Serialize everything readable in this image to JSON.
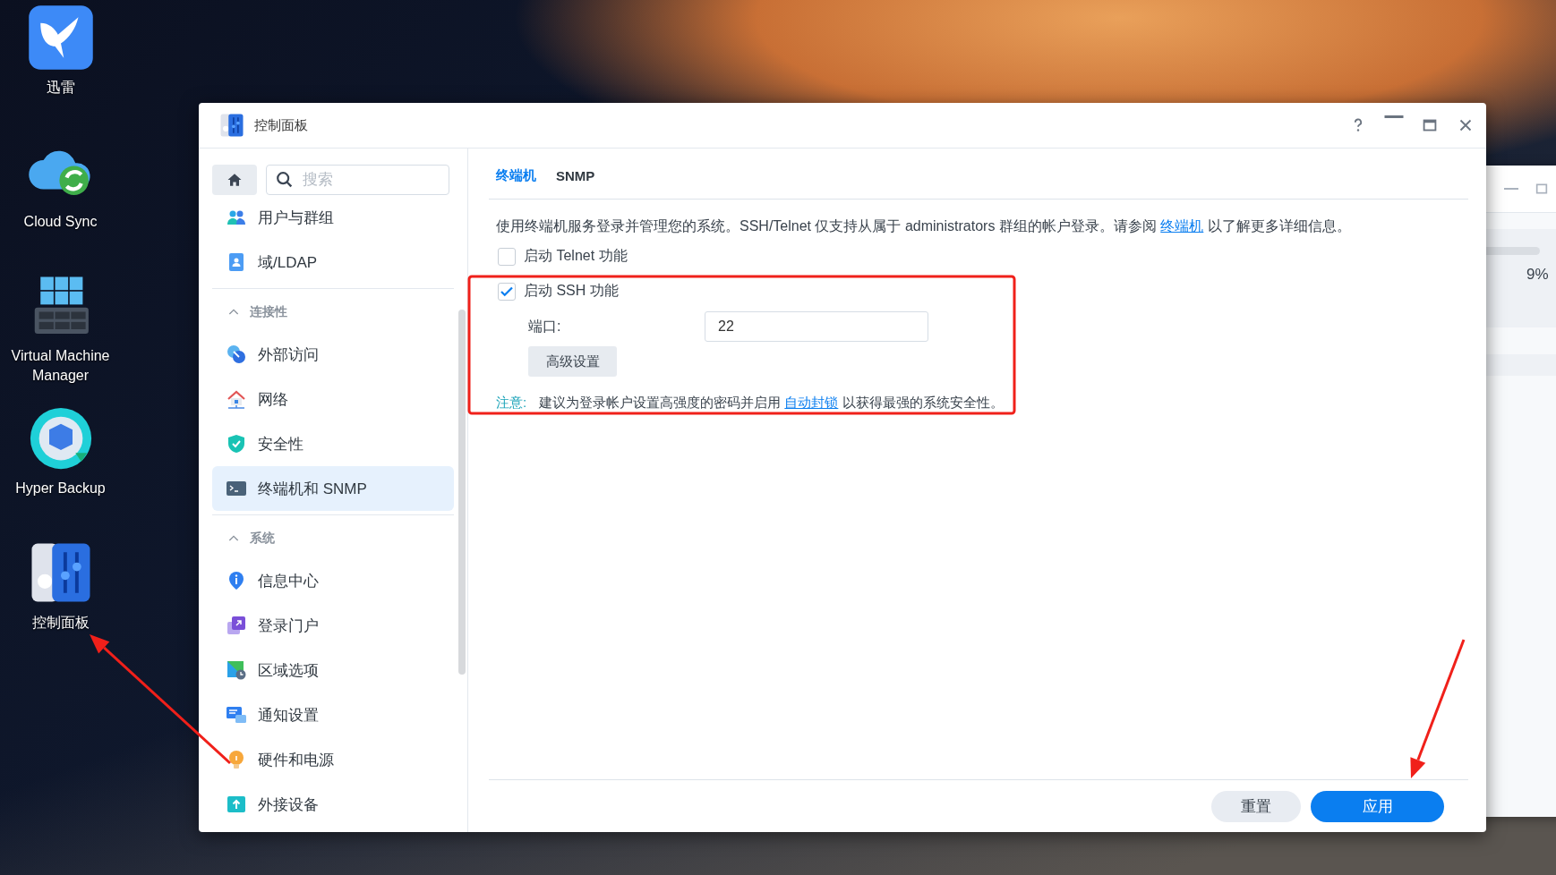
{
  "desktop_icons": [
    {
      "label": "迅雷"
    },
    {
      "label": "Cloud Sync"
    },
    {
      "label": "Virtual Machine Manager"
    },
    {
      "label": "Hyper Backup"
    },
    {
      "label": "控制面板"
    }
  ],
  "window": {
    "title": "控制面板"
  },
  "sidebar": {
    "search": {
      "placeholder": "搜索"
    },
    "groups": [
      {
        "items": [
          {
            "label": "用户与群组",
            "selected": false
          },
          {
            "label": "域/LDAP",
            "selected": false
          }
        ]
      },
      {
        "header": "连接性",
        "expanded": true,
        "items": [
          {
            "label": "外部访问",
            "selected": false
          },
          {
            "label": "网络",
            "selected": false
          },
          {
            "label": "安全性",
            "selected": false
          },
          {
            "label": "终端机和 SNMP",
            "selected": true
          }
        ]
      },
      {
        "header": "系统",
        "expanded": true,
        "items": [
          {
            "label": "信息中心",
            "selected": false
          },
          {
            "label": "登录门户",
            "selected": false
          },
          {
            "label": "区域选项",
            "selected": false
          },
          {
            "label": "通知设置",
            "selected": false
          },
          {
            "label": "硬件和电源",
            "selected": false
          },
          {
            "label": "外接设备",
            "selected": false
          }
        ]
      }
    ]
  },
  "content": {
    "tabs": [
      {
        "label": "终端机",
        "selected": true
      },
      {
        "label": "SNMP",
        "selected": false
      }
    ],
    "description": {
      "before": "使用终端机服务登录并管理您的系统。SSH/Telnet 仅支持从属于 administrators 群组的帐户登录。请参阅 ",
      "link": "终端机",
      "after": " 以了解更多详细信息。"
    },
    "options": [
      {
        "label": "启动 Telnet 功能",
        "checked": false
      },
      {
        "label": "启动 SSH 功能",
        "checked": true
      }
    ],
    "port": {
      "label": "端口:",
      "value": "22"
    },
    "advanced_button": "高级设置",
    "note": {
      "label": "注意:",
      "before": "建议为登录帐户设置高强度的密码并启用 ",
      "link": "自动封锁",
      "after": " 以获得最强的系统安全性。"
    },
    "buttons": [
      {
        "label": "重置",
        "kind": "secondary"
      },
      {
        "label": "应用",
        "kind": "primary"
      }
    ]
  },
  "background_window": {
    "reading": "9%"
  },
  "annotations": [
    {
      "kind": "rectangle"
    },
    {
      "kind": "arrow"
    },
    {
      "kind": "arrow"
    }
  ]
}
